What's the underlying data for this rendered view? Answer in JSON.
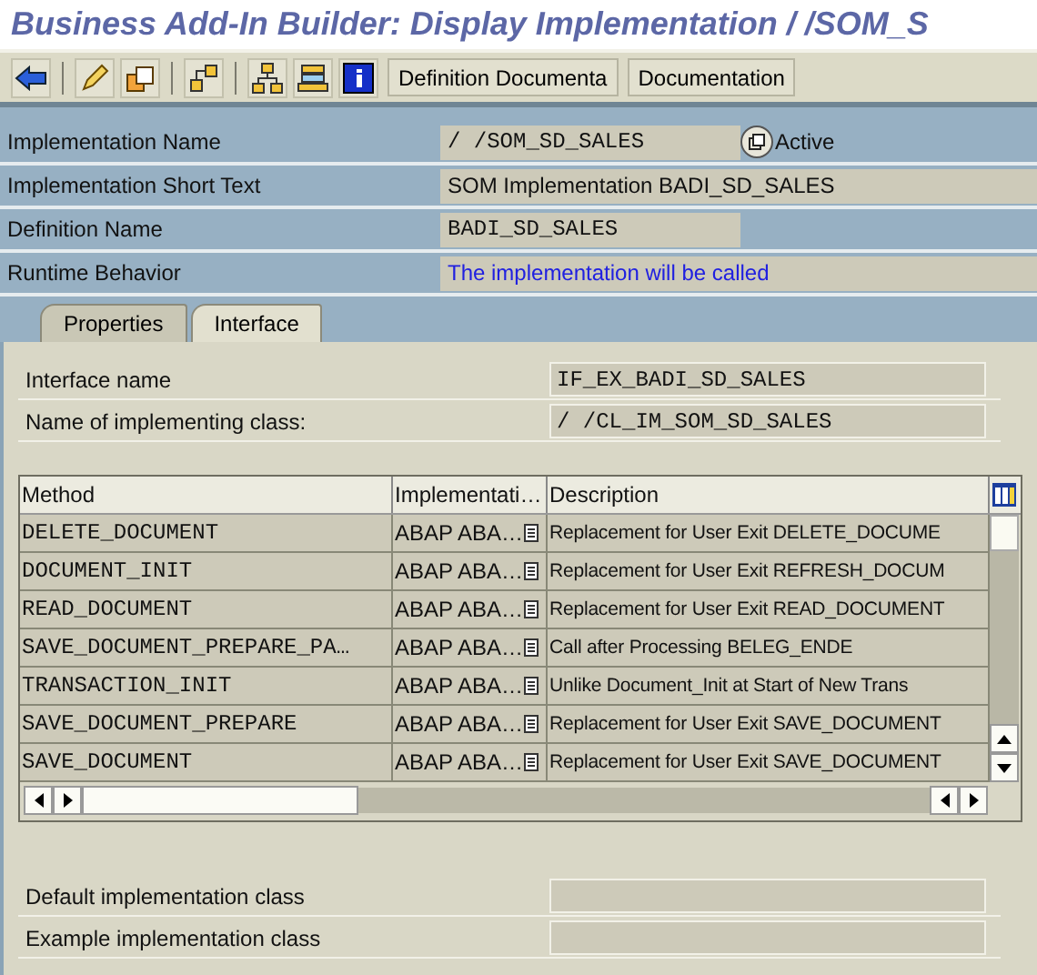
{
  "window": {
    "title": "Business Add-In Builder: Display Implementation /      /SOM_S"
  },
  "toolbar": {
    "buttons": [
      "Definition Documenta",
      "Documentation"
    ]
  },
  "header": [
    {
      "label": "Implementation Name",
      "value": "/     /SOM_SD_SALES",
      "kind": "mono",
      "status": "Active"
    },
    {
      "label": "Implementation Short Text",
      "value": "SOM Implementation BADI_SD_SALES",
      "kind": "text"
    },
    {
      "label": "Definition Name",
      "value": "BADI_SD_SALES",
      "kind": "mono"
    },
    {
      "label": "Runtime Behavior",
      "value": "The implementation will be called",
      "kind": "info"
    }
  ],
  "tabs": [
    {
      "label": "Properties",
      "selected": false
    },
    {
      "label": "Interface",
      "selected": true
    }
  ],
  "interface": [
    {
      "label": "Interface name",
      "value": "IF_EX_BADI_SD_SALES"
    },
    {
      "label": "Name of implementing class:",
      "value": "/     /CL_IM_SOM_SD_SALES"
    }
  ],
  "table": {
    "columns": [
      "Method",
      "Implementati…",
      "Description"
    ],
    "rows": [
      {
        "method": "DELETE_DOCUMENT",
        "implementation": "ABAP ABA…",
        "description": "Replacement for User Exit DELETE_DOCUME"
      },
      {
        "method": "DOCUMENT_INIT",
        "implementation": "ABAP ABA…",
        "description": "Replacement for User Exit REFRESH_DOCUM"
      },
      {
        "method": "READ_DOCUMENT",
        "implementation": "ABAP ABA…",
        "description": "Replacement for User Exit READ_DOCUMENT"
      },
      {
        "method": "SAVE_DOCUMENT_PREPARE_PA…",
        "implementation": "ABAP ABA…",
        "description": "Call after Processing BELEG_ENDE"
      },
      {
        "method": "TRANSACTION_INIT",
        "implementation": "ABAP ABA…",
        "description": "Unlike Document_Init at Start of New Trans"
      },
      {
        "method": "SAVE_DOCUMENT_PREPARE",
        "implementation": "ABAP ABA…",
        "description": "Replacement for User Exit SAVE_DOCUMENT"
      },
      {
        "method": "SAVE_DOCUMENT",
        "implementation": "ABAP ABA…",
        "description": "Replacement for User Exit SAVE_DOCUMENT"
      }
    ]
  },
  "classes": [
    {
      "label": "Default implementation class"
    },
    {
      "label": "Example implementation class"
    }
  ]
}
